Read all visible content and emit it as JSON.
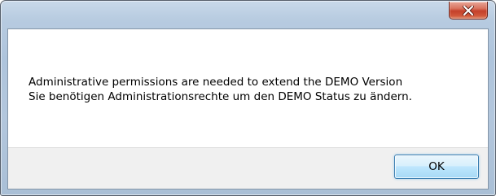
{
  "dialog": {
    "close_icon": "close-icon",
    "message_lines": [
      "Administrative permissions are needed to extend the DEMO Version",
      "Sie benötigen Administrationsrechte um den DEMO Status zu ändern."
    ],
    "ok_label": "OK"
  },
  "colors": {
    "close_button": "#c4402a",
    "ok_border": "#3c7fb1",
    "button_bar": "#f0f0f0",
    "window_frame": "#b3c7dd"
  }
}
